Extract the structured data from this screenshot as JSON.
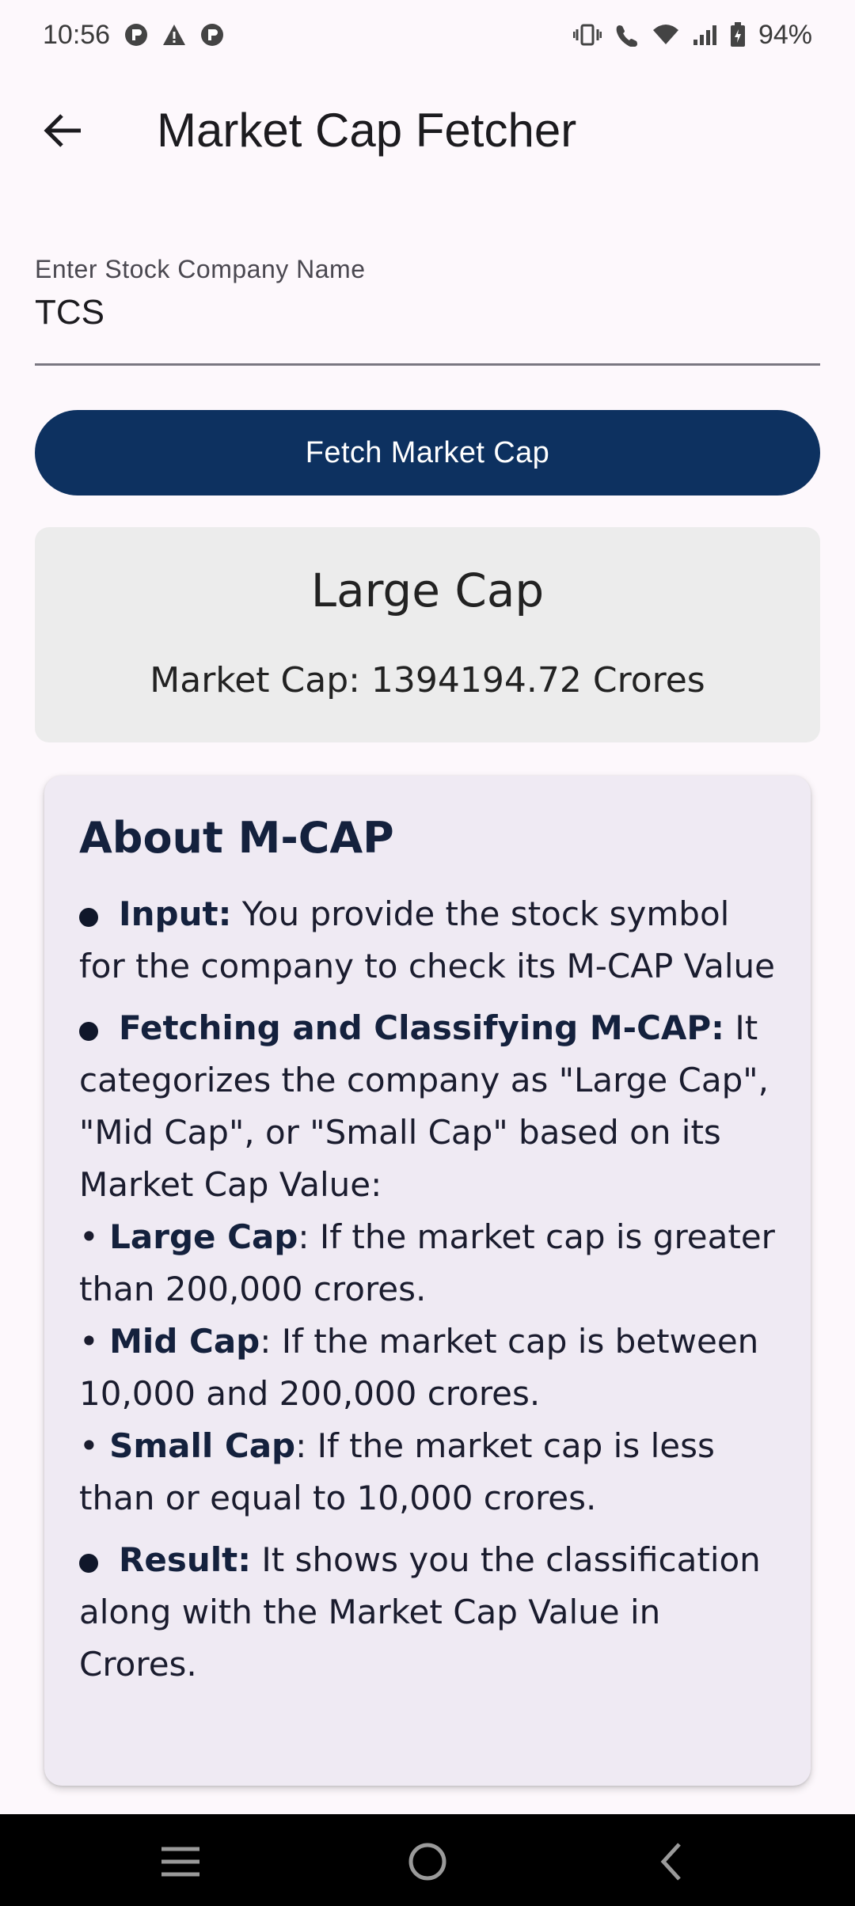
{
  "status_bar": {
    "time": "10:56",
    "battery": "94%"
  },
  "app_bar": {
    "title": "Market Cap Fetcher"
  },
  "form": {
    "label": "Enter Stock Company Name",
    "value": "TCS",
    "button_label": "Fetch Market Cap"
  },
  "result": {
    "classification": "Large Cap",
    "market_cap_text": "Market Cap: 1394194.72 Crores"
  },
  "about": {
    "title": "About M-CAP",
    "input_heading": "Input:",
    "input_text": " You provide the stock symbol for the company to check its M-CAP Value",
    "fetch_heading": "Fetching and Classifying M-CAP:",
    "fetch_text": " It categorizes the company as \"Large Cap\", \"Mid Cap\", or \"Small Cap\" based on its Market Cap Value:",
    "large_heading": "Large Cap",
    "large_text": ": If the market cap is greater than 200,000 crores.",
    "mid_heading": "Mid Cap",
    "mid_text": ": If the market cap is between 10,000 and 200,000 crores.",
    "small_heading": "Small Cap",
    "small_text": ": If the market cap is less than or equal to 10,000 crores.",
    "result_heading": "Result:",
    "result_text": " It shows you the classification along with the Market Cap Value in Crores."
  },
  "colors": {
    "background": "#fdf8fc",
    "button": "#0d3160",
    "result_card": "#ececec",
    "about_card": "#efeaf3",
    "heading_text": "#14213d"
  },
  "icons": {
    "back": "arrow-left-icon",
    "nav_recents": "menu-lines-icon",
    "nav_home": "circle-home-icon",
    "nav_back": "chevron-left-icon"
  }
}
